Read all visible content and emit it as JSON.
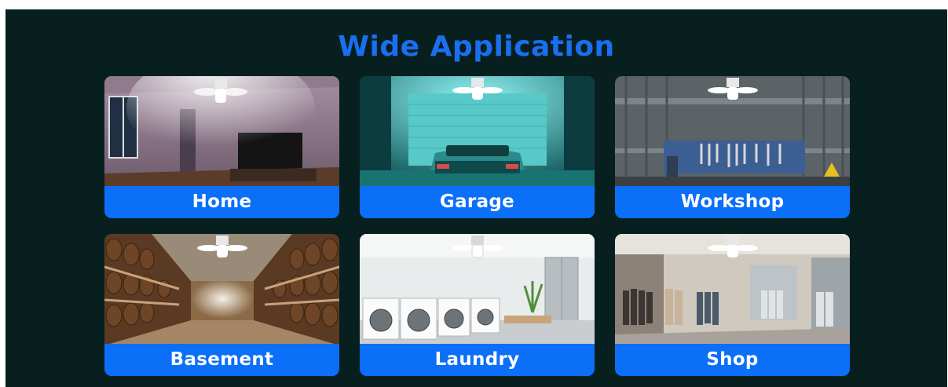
{
  "title": "Wide Application",
  "applications": [
    {
      "label": "Home",
      "scene_icon": "home-scene-icon"
    },
    {
      "label": "Garage",
      "scene_icon": "garage-scene-icon"
    },
    {
      "label": "Workshop",
      "scene_icon": "workshop-scene-icon"
    },
    {
      "label": "Basement",
      "scene_icon": "basement-scene-icon"
    },
    {
      "label": "Laundry",
      "scene_icon": "laundry-scene-icon"
    },
    {
      "label": "Shop",
      "scene_icon": "shop-scene-icon"
    }
  ],
  "colors": {
    "background": "#081f20",
    "title": "#1a6ff0",
    "label_bar": "#0b6ff8",
    "label_text": "#ffffff"
  }
}
